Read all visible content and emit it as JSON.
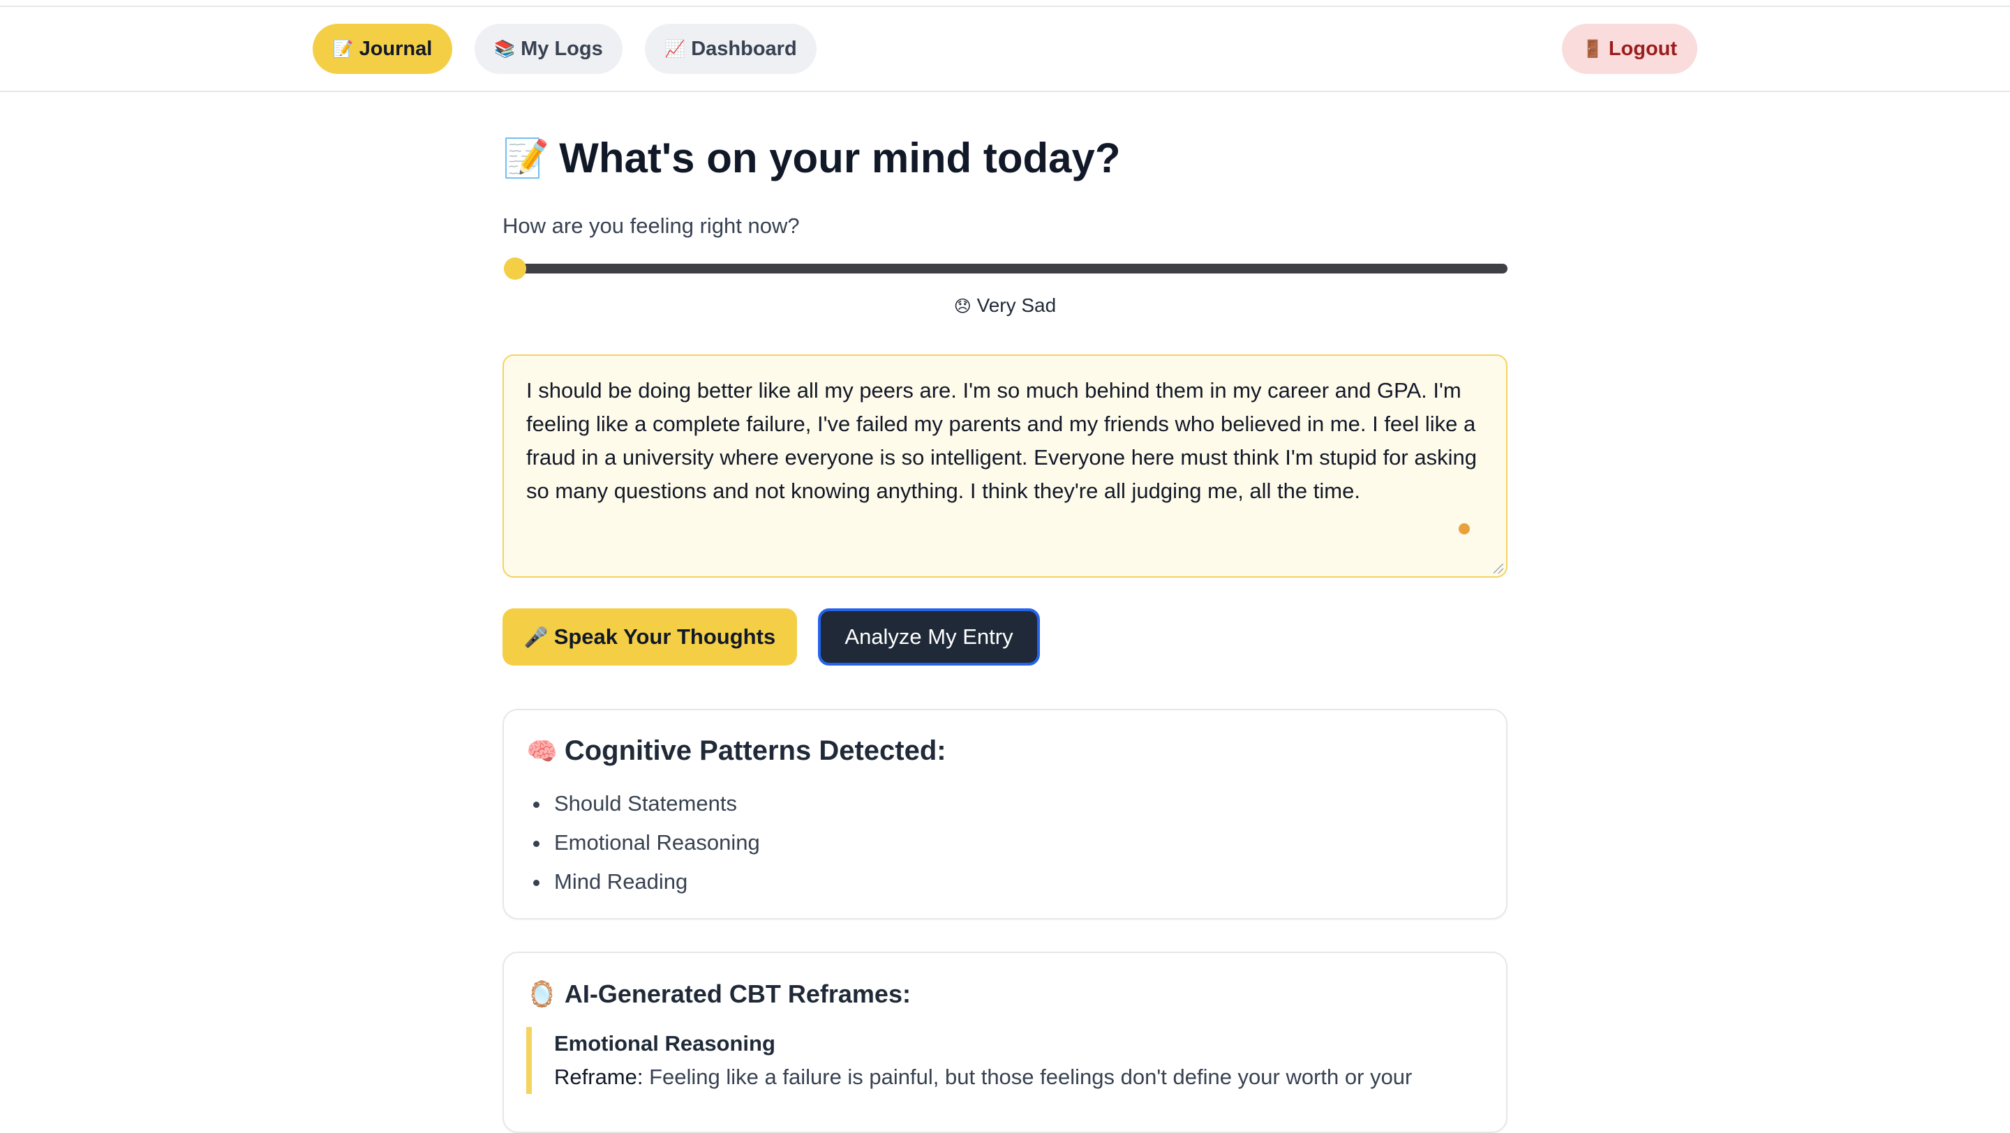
{
  "nav": {
    "items": [
      {
        "icon": "memo-icon",
        "glyph": "📝",
        "label": "Journal",
        "active": true
      },
      {
        "icon": "books-icon",
        "glyph": "📚",
        "label": "My Logs",
        "active": false
      },
      {
        "icon": "chart-icon",
        "glyph": "📈",
        "label": "Dashboard",
        "active": false
      }
    ],
    "logout": {
      "icon": "door-icon",
      "glyph": "🚪",
      "label": "Logout"
    }
  },
  "page": {
    "title_glyph": "📝",
    "title": "What's on your mind today?"
  },
  "mood": {
    "label": "How are you feeling right now?",
    "level": 0,
    "emoji": "😞",
    "value_label": "Very Sad"
  },
  "entry": {
    "text": "I should be doing better like all my peers are. I'm so much behind them in my career and GPA. I'm feeling like a complete failure, I've failed my parents and my friends who believed in me. I feel like a fraud in a university where everyone is so intelligent. Everyone here must think I'm stupid for asking so many questions and not knowing anything. I think they're all judging me, all the time."
  },
  "actions": {
    "speak_glyph": "🎤",
    "speak_label": "Speak Your Thoughts",
    "analyze_label": "Analyze My Entry"
  },
  "patterns": {
    "glyph": "🧠",
    "heading": "Cognitive Patterns Detected:",
    "items": [
      "Should Statements",
      "Emotional Reasoning",
      "Mind Reading"
    ]
  },
  "reframes": {
    "glyph": "🪞",
    "heading": "AI-Generated CBT Reframes:",
    "items": [
      {
        "title": "Emotional Reasoning",
        "label": "Reframe:",
        "text": "Feeling like a failure is painful, but those feelings don't define your worth or your"
      }
    ]
  },
  "colors": {
    "accent": "#f4cf46",
    "dark_button": "#1f2937",
    "focus_ring": "#2563eb",
    "logout_bg": "#fadcdc",
    "logout_text": "#9b1c1c",
    "entry_bg": "#fffbea"
  }
}
